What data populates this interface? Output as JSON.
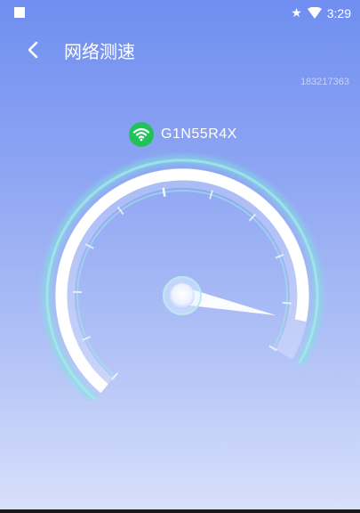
{
  "status_bar": {
    "time": "3:29",
    "icons": [
      "square-icon",
      "star-icon",
      "wifi-signal-icon"
    ]
  },
  "header": {
    "title": "网络测速",
    "back_icon": "chevron-left-icon"
  },
  "device_id": "183217363",
  "wifi": {
    "icon": "wifi-icon",
    "name": "G1N55R4X"
  },
  "gauge": {
    "reading_fraction": 0.93
  },
  "colors": {
    "wifi_badge": "#22c25a",
    "gauge_glow": "#7fe3e0",
    "background_top": "#6f8ef0",
    "background_bottom": "#d7e0fb"
  }
}
